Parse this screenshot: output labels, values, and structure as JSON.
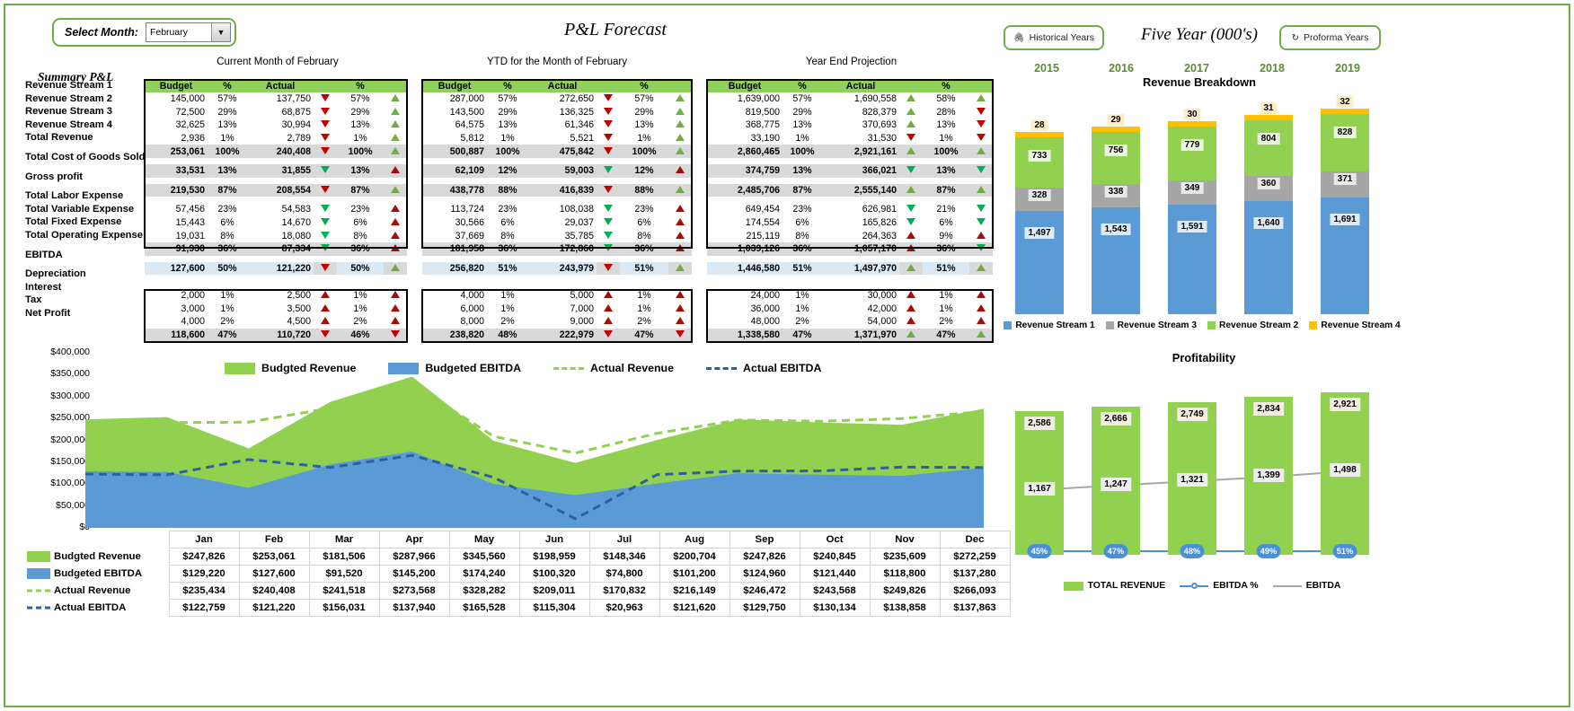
{
  "header": {
    "select_month_label": "Select Month:",
    "selected_month": "February",
    "dropdown_icon": "chevron-down-icon",
    "title": "P&L Forecast",
    "historical_button": "Historical Years",
    "historical_icon": "stamp-icon",
    "proforma_button": "Proforma Years",
    "proforma_icon": "refresh-icon",
    "five_year_title": "Five  Year (000's)"
  },
  "summary": {
    "label": "Summary P&L",
    "table_titles": {
      "current": "Current Month of February",
      "ytd": "YTD for the Month of February",
      "yearend": "Year End Projection"
    },
    "columns": [
      "Budget",
      "%",
      "Actual",
      "",
      "%",
      ""
    ],
    "row_labels": [
      "Revenue Stream 1",
      "Revenue Stream 2",
      "Revenue Stream 3",
      "Revenue Stream 4",
      "Total Revenue",
      "Total Cost of Goods Sold",
      "Gross profit",
      "Total Labor Expense",
      "Total Variable Expense",
      "Total Fixed Expense",
      "Total Operating Expense",
      "EBITDA",
      "Depreciation",
      "Interest",
      "Tax",
      "Net Profit"
    ],
    "current": [
      {
        "budget": "145,000",
        "bpct": "57%",
        "actual": "137,750",
        "a1": "down-red",
        "apct": "57%",
        "a2": "up-green"
      },
      {
        "budget": "72,500",
        "bpct": "29%",
        "actual": "68,875",
        "a1": "down-red",
        "apct": "29%",
        "a2": "up-green"
      },
      {
        "budget": "32,625",
        "bpct": "13%",
        "actual": "30,994",
        "a1": "down-red",
        "apct": "13%",
        "a2": "up-green"
      },
      {
        "budget": "2,936",
        "bpct": "1%",
        "actual": "2,789",
        "a1": "down-red",
        "apct": "1%",
        "a2": "up-green"
      },
      {
        "budget": "253,061",
        "bpct": "100%",
        "actual": "240,408",
        "a1": "down-red",
        "apct": "100%",
        "a2": "up-green"
      },
      {
        "budget": "33,531",
        "bpct": "13%",
        "actual": "31,855",
        "a1": "down-green",
        "apct": "13%",
        "a2": "up-red"
      },
      {
        "budget": "219,530",
        "bpct": "87%",
        "actual": "208,554",
        "a1": "down-red",
        "apct": "87%",
        "a2": "up-green"
      },
      {
        "budget": "57,456",
        "bpct": "23%",
        "actual": "54,583",
        "a1": "down-green",
        "apct": "23%",
        "a2": "up-red"
      },
      {
        "budget": "15,443",
        "bpct": "6%",
        "actual": "14,670",
        "a1": "down-green",
        "apct": "6%",
        "a2": "up-red"
      },
      {
        "budget": "19,031",
        "bpct": "8%",
        "actual": "18,080",
        "a1": "down-green",
        "apct": "8%",
        "a2": "up-red"
      },
      {
        "budget": "91,930",
        "bpct": "36%",
        "actual": "87,334",
        "a1": "down-green",
        "apct": "36%",
        "a2": "up-red"
      },
      {
        "budget": "127,600",
        "bpct": "50%",
        "actual": "121,220",
        "a1": "down-red",
        "apct": "50%",
        "a2": "up-green"
      },
      {
        "budget": "2,000",
        "bpct": "1%",
        "actual": "2,500",
        "a1": "up-red",
        "apct": "1%",
        "a2": "up-red"
      },
      {
        "budget": "3,000",
        "bpct": "1%",
        "actual": "3,500",
        "a1": "up-red",
        "apct": "1%",
        "a2": "up-red"
      },
      {
        "budget": "4,000",
        "bpct": "2%",
        "actual": "4,500",
        "a1": "up-red",
        "apct": "2%",
        "a2": "up-red"
      },
      {
        "budget": "118,600",
        "bpct": "47%",
        "actual": "110,720",
        "a1": "down-red",
        "apct": "46%",
        "a2": "down-red"
      }
    ],
    "ytd": [
      {
        "budget": "287,000",
        "bpct": "57%",
        "actual": "272,650",
        "a1": "down-red",
        "apct": "57%",
        "a2": "up-green"
      },
      {
        "budget": "143,500",
        "bpct": "29%",
        "actual": "136,325",
        "a1": "down-red",
        "apct": "29%",
        "a2": "up-green"
      },
      {
        "budget": "64,575",
        "bpct": "13%",
        "actual": "61,346",
        "a1": "down-red",
        "apct": "13%",
        "a2": "up-green"
      },
      {
        "budget": "5,812",
        "bpct": "1%",
        "actual": "5,521",
        "a1": "down-red",
        "apct": "1%",
        "a2": "up-green"
      },
      {
        "budget": "500,887",
        "bpct": "100%",
        "actual": "475,842",
        "a1": "down-red",
        "apct": "100%",
        "a2": "up-green"
      },
      {
        "budget": "62,109",
        "bpct": "12%",
        "actual": "59,003",
        "a1": "down-green",
        "apct": "12%",
        "a2": "up-red"
      },
      {
        "budget": "438,778",
        "bpct": "88%",
        "actual": "416,839",
        "a1": "down-red",
        "apct": "88%",
        "a2": "up-green"
      },
      {
        "budget": "113,724",
        "bpct": "23%",
        "actual": "108,038",
        "a1": "down-green",
        "apct": "23%",
        "a2": "up-red"
      },
      {
        "budget": "30,566",
        "bpct": "6%",
        "actual": "29,037",
        "a1": "down-green",
        "apct": "6%",
        "a2": "up-red"
      },
      {
        "budget": "37,669",
        "bpct": "8%",
        "actual": "35,785",
        "a1": "down-green",
        "apct": "8%",
        "a2": "up-red"
      },
      {
        "budget": "181,958",
        "bpct": "36%",
        "actual": "172,860",
        "a1": "down-green",
        "apct": "36%",
        "a2": "up-red"
      },
      {
        "budget": "256,820",
        "bpct": "51%",
        "actual": "243,979",
        "a1": "down-red",
        "apct": "51%",
        "a2": "up-green"
      },
      {
        "budget": "4,000",
        "bpct": "1%",
        "actual": "5,000",
        "a1": "up-red",
        "apct": "1%",
        "a2": "up-red"
      },
      {
        "budget": "6,000",
        "bpct": "1%",
        "actual": "7,000",
        "a1": "up-red",
        "apct": "1%",
        "a2": "up-red"
      },
      {
        "budget": "8,000",
        "bpct": "2%",
        "actual": "9,000",
        "a1": "up-red",
        "apct": "2%",
        "a2": "up-red"
      },
      {
        "budget": "238,820",
        "bpct": "48%",
        "actual": "222,979",
        "a1": "down-red",
        "apct": "47%",
        "a2": "down-red"
      }
    ],
    "yearend": [
      {
        "budget": "1,639,000",
        "bpct": "57%",
        "actual": "1,690,558",
        "a1": "up-green",
        "apct": "58%",
        "a2": "up-green"
      },
      {
        "budget": "819,500",
        "bpct": "29%",
        "actual": "828,379",
        "a1": "up-green",
        "apct": "28%",
        "a2": "down-red"
      },
      {
        "budget": "368,775",
        "bpct": "13%",
        "actual": "370,693",
        "a1": "up-green",
        "apct": "13%",
        "a2": "down-red"
      },
      {
        "budget": "33,190",
        "bpct": "1%",
        "actual": "31,530",
        "a1": "down-red",
        "apct": "1%",
        "a2": "down-red"
      },
      {
        "budget": "2,860,465",
        "bpct": "100%",
        "actual": "2,921,161",
        "a1": "up-green",
        "apct": "100%",
        "a2": "up-green"
      },
      {
        "budget": "374,759",
        "bpct": "13%",
        "actual": "366,021",
        "a1": "down-green",
        "apct": "13%",
        "a2": "down-green"
      },
      {
        "budget": "2,485,706",
        "bpct": "87%",
        "actual": "2,555,140",
        "a1": "up-green",
        "apct": "87%",
        "a2": "up-green"
      },
      {
        "budget": "649,454",
        "bpct": "23%",
        "actual": "626,981",
        "a1": "down-green",
        "apct": "21%",
        "a2": "down-green"
      },
      {
        "budget": "174,554",
        "bpct": "6%",
        "actual": "165,826",
        "a1": "down-green",
        "apct": "6%",
        "a2": "down-green"
      },
      {
        "budget": "215,119",
        "bpct": "8%",
        "actual": "264,363",
        "a1": "up-red",
        "apct": "9%",
        "a2": "up-red"
      },
      {
        "budget": "1,039,126",
        "bpct": "36%",
        "actual": "1,057,170",
        "a1": "up-red",
        "apct": "36%",
        "a2": "down-green"
      },
      {
        "budget": "1,446,580",
        "bpct": "51%",
        "actual": "1,497,970",
        "a1": "up-green",
        "apct": "51%",
        "a2": "up-green"
      },
      {
        "budget": "24,000",
        "bpct": "1%",
        "actual": "30,000",
        "a1": "up-red",
        "apct": "1%",
        "a2": "up-red"
      },
      {
        "budget": "36,000",
        "bpct": "1%",
        "actual": "42,000",
        "a1": "up-red",
        "apct": "1%",
        "a2": "up-red"
      },
      {
        "budget": "48,000",
        "bpct": "2%",
        "actual": "54,000",
        "a1": "up-red",
        "apct": "2%",
        "a2": "up-red"
      },
      {
        "budget": "1,338,580",
        "bpct": "47%",
        "actual": "1,371,970",
        "a1": "up-green",
        "apct": "47%",
        "a2": "up-green"
      }
    ]
  },
  "chart_data": [
    {
      "type": "area",
      "title": "",
      "xlabel": "",
      "ylabel": "",
      "ylim": [
        0,
        400000
      ],
      "yticks": [
        "$0",
        "$50,000",
        "$100,000",
        "$150,000",
        "$200,000",
        "$250,000",
        "$300,000",
        "$350,000",
        "$400,000"
      ],
      "categories": [
        "Jan",
        "Feb",
        "Mar",
        "Apr",
        "May",
        "Jun",
        "Jul",
        "Aug",
        "Sep",
        "Oct",
        "Nov",
        "Dec"
      ],
      "legend": [
        "Budgted Revenue",
        "Budgeted EBITDA",
        "Actual Revenue",
        "Actual EBITDA"
      ],
      "legend_position": "top",
      "grid": false,
      "series": [
        {
          "name": "Budgted Revenue",
          "kind": "area",
          "color": "#92d050",
          "values": [
            247826,
            253061,
            181506,
            287966,
            345560,
            198959,
            148346,
            200704,
            247826,
            240845,
            235609,
            272259
          ],
          "labels": [
            "$247,826",
            "$253,061",
            "$181,506",
            "$287,966",
            "$345,560",
            "$198,959",
            "$148,346",
            "$200,704",
            "$247,826",
            "$240,845",
            "$235,609",
            "$272,259"
          ]
        },
        {
          "name": "Budgeted EBITDA",
          "kind": "area",
          "color": "#5b9bd5",
          "values": [
            129220,
            127600,
            91520,
            145200,
            174240,
            100320,
            74800,
            101200,
            124960,
            121440,
            118800,
            137280
          ],
          "labels": [
            "$129,220",
            "$127,600",
            "$91,520",
            "$145,200",
            "$174,240",
            "$100,320",
            "$74,800",
            "$101,200",
            "$124,960",
            "$121,440",
            "$118,800",
            "$137,280"
          ]
        },
        {
          "name": "Actual Revenue",
          "kind": "dashed-line",
          "color": "#92d050",
          "values": [
            235434,
            240408,
            241518,
            273568,
            328282,
            209011,
            170832,
            216149,
            246472,
            243568,
            249826,
            266093
          ],
          "labels": [
            "$235,434",
            "$240,408",
            "$241,518",
            "$273,568",
            "$328,282",
            "$209,011",
            "$170,832",
            "$216,149",
            "$246,472",
            "$243,568",
            "$249,826",
            "$266,093"
          ]
        },
        {
          "name": "Actual EBITDA",
          "kind": "dashed-line",
          "color": "#2e5fa3",
          "values": [
            122759,
            121220,
            156031,
            137940,
            165528,
            115304,
            20963,
            121620,
            129750,
            130134,
            138858,
            137863
          ],
          "labels": [
            "$122,759",
            "$121,220",
            "$156,031",
            "$137,940",
            "$165,528",
            "$115,304",
            "$20,963",
            "$121,620",
            "$129,750",
            "$130,134",
            "$138,858",
            "$137,863"
          ]
        }
      ]
    },
    {
      "type": "bar",
      "title": "Revenue Breakdown",
      "stacked": true,
      "categories": [
        "2015",
        "2016",
        "2017",
        "2018",
        "2019"
      ],
      "legend": [
        "Revenue Stream 1",
        "Revenue Stream 3",
        "Revenue Stream 2",
        "Revenue Stream 4"
      ],
      "legend_position": "bottom",
      "series": [
        {
          "name": "Revenue Stream 1",
          "color": "#5b9bd5",
          "values": [
            1497,
            1543,
            1591,
            1640,
            1691
          ],
          "labels": [
            "1,497",
            "1,543",
            "1,591",
            "1,640",
            "1,691"
          ]
        },
        {
          "name": "Revenue Stream 3",
          "color": "#a6a6a6",
          "values": [
            328,
            338,
            349,
            360,
            371
          ],
          "labels": [
            "328",
            "338",
            "349",
            "360",
            "371"
          ]
        },
        {
          "name": "Revenue Stream 2",
          "color": "#92d050",
          "values": [
            733,
            756,
            779,
            804,
            828
          ],
          "labels": [
            "733",
            "756",
            "779",
            "804",
            "828"
          ]
        },
        {
          "name": "Revenue Stream 4",
          "color": "#ffc000",
          "values": [
            28,
            29,
            30,
            31,
            32
          ],
          "labels": [
            "28",
            "29",
            "30",
            "31",
            "32"
          ]
        }
      ]
    },
    {
      "type": "bar",
      "title": "Profitability",
      "categories": [
        "2015",
        "2016",
        "2017",
        "2018",
        "2019"
      ],
      "legend": [
        "TOTAL REVENUE",
        "EBITDA %",
        "EBITDA"
      ],
      "legend_position": "bottom",
      "series": [
        {
          "name": "TOTAL REVENUE",
          "kind": "bar",
          "color": "#92d050",
          "values": [
            2586,
            2666,
            2749,
            2834,
            2921
          ],
          "labels": [
            "2,586",
            "2,666",
            "2,749",
            "2,834",
            "2,921"
          ]
        },
        {
          "name": "EBITDA",
          "kind": "line",
          "color": "#a6a6a6",
          "values": [
            1167,
            1247,
            1321,
            1399,
            1498
          ],
          "labels": [
            "1,167",
            "1,247",
            "1,321",
            "1,399",
            "1,498"
          ]
        },
        {
          "name": "EBITDA %",
          "kind": "line",
          "color": "#4a90d9",
          "values": [
            45,
            47,
            48,
            49,
            51
          ],
          "labels": [
            "45%",
            "47%",
            "48%",
            "49%",
            "51%"
          ]
        }
      ]
    }
  ],
  "year_headers": [
    "2015",
    "2016",
    "2017",
    "2018",
    "2019"
  ]
}
